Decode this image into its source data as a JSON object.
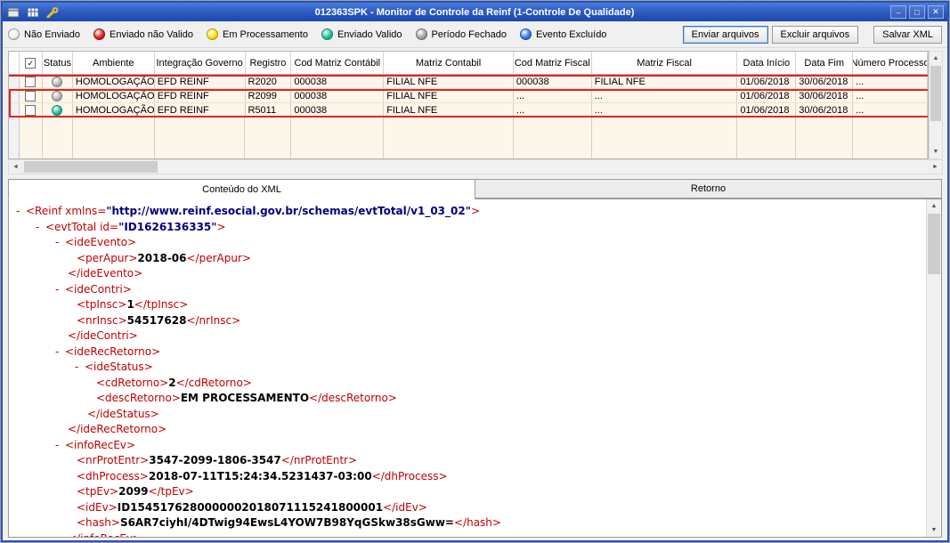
{
  "window": {
    "title": "012363SPK - Monitor de Controle da Reinf (1-Controle De Qualidade)"
  },
  "icons": {
    "minimize": "–",
    "maximize": "□",
    "close": "✕",
    "check": "✓",
    "up": "▲",
    "down": "▼",
    "left": "◄",
    "right": "►"
  },
  "legend": {
    "items": [
      {
        "label": "Não Enviado",
        "color": "#f2f2f2",
        "edge": "#9a9a9a"
      },
      {
        "label": "Enviado não Valido",
        "color": "#e22820",
        "edge": "#8f100c"
      },
      {
        "label": "Em Processamento",
        "color": "#ffe312",
        "edge": "#b09a00"
      },
      {
        "label": "Enviado Valido",
        "color": "#23bd9a",
        "edge": "#0e8a6e"
      },
      {
        "label": "Período Fechado",
        "color": "#a6a6a6",
        "edge": "#6e6e6e"
      },
      {
        "label": "Evento Excluído",
        "color": "#3b7fe0",
        "edge": "#1a4e9e"
      }
    ]
  },
  "actions": {
    "send": "Enviar arquivos",
    "delete": "Excluir arquivos",
    "save": "Salvar XML"
  },
  "grid": {
    "columns": [
      "",
      "",
      "Status",
      "Ambiente",
      "Integração Governo",
      "Registro",
      "Cod Matriz Contábil",
      "Matriz Contabil",
      "Cod Matriz Fiscal",
      "Matriz Fiscal",
      "Data Início",
      "Data Fim",
      "Número Processo"
    ],
    "status_colors": {
      "gray": {
        "fill": "#b8b8b8",
        "edge": "#7e7e7e"
      },
      "green": {
        "fill": "#23bd9a",
        "edge": "#0e8a6e"
      }
    },
    "rows": [
      {
        "checked": false,
        "status": "gray",
        "cells": [
          "HOMOLOGAÇÃO",
          "EFD REINF",
          "R2020",
          "000038",
          "FILIAL NFE",
          "000038",
          "FILIAL NFE",
          "01/06/2018",
          "30/06/2018",
          "..."
        ]
      },
      {
        "checked": false,
        "status": "gray",
        "cells": [
          "HOMOLOGAÇÃO",
          "EFD REINF",
          "R2099",
          "000038",
          "FILIAL NFE",
          "...",
          "...",
          "01/06/2018",
          "30/06/2018",
          "..."
        ]
      },
      {
        "checked": false,
        "status": "green",
        "cells": [
          "HOMOLOGAÇÃO",
          "EFD REINF",
          "R5011",
          "000038",
          "FILIAL NFE",
          "...",
          "...",
          "01/06/2018",
          "30/06/2018",
          "..."
        ]
      }
    ]
  },
  "tabs": [
    {
      "label": "Conteúdo do XML"
    },
    {
      "label": "Retorno"
    }
  ],
  "xml": {
    "lines": [
      {
        "pad": 8,
        "m": true,
        "p": [
          {
            "t": "tag",
            "v": "<Reinf xmlns="
          },
          {
            "t": "val",
            "v": "\"http://www.reinf.esocial.gov.br/schemas/evtTotal/v1_03_02\""
          },
          {
            "t": "tag",
            "v": ">"
          }
        ]
      },
      {
        "pad": 30,
        "m": true,
        "p": [
          {
            "t": "tag",
            "v": "<evtTotal id="
          },
          {
            "t": "val",
            "v": "\"ID1626136335\""
          },
          {
            "t": "tag",
            "v": ">"
          }
        ]
      },
      {
        "pad": 52,
        "m": true,
        "p": [
          {
            "t": "tag",
            "v": "<ideEvento>"
          }
        ]
      },
      {
        "pad": 76,
        "m": false,
        "p": [
          {
            "t": "tag",
            "v": "<perApur>"
          },
          {
            "t": "txt",
            "v": "2018-06"
          },
          {
            "t": "tag",
            "v": "</perApur>"
          }
        ]
      },
      {
        "pad": 66,
        "m": false,
        "p": [
          {
            "t": "tag",
            "v": "</ideEvento>"
          }
        ]
      },
      {
        "pad": 52,
        "m": true,
        "p": [
          {
            "t": "tag",
            "v": "<ideContri>"
          }
        ]
      },
      {
        "pad": 76,
        "m": false,
        "p": [
          {
            "t": "tag",
            "v": "<tpInsc>"
          },
          {
            "t": "txt",
            "v": "1"
          },
          {
            "t": "tag",
            "v": "</tpInsc>"
          }
        ]
      },
      {
        "pad": 76,
        "m": false,
        "p": [
          {
            "t": "tag",
            "v": "<nrInsc>"
          },
          {
            "t": "txt",
            "v": "54517628"
          },
          {
            "t": "tag",
            "v": "</nrInsc>"
          }
        ]
      },
      {
        "pad": 66,
        "m": false,
        "p": [
          {
            "t": "tag",
            "v": "</ideContri>"
          }
        ]
      },
      {
        "pad": 52,
        "m": true,
        "p": [
          {
            "t": "tag",
            "v": "<ideRecRetorno>"
          }
        ]
      },
      {
        "pad": 74,
        "m": true,
        "p": [
          {
            "t": "tag",
            "v": "<ideStatus>"
          }
        ]
      },
      {
        "pad": 98,
        "m": false,
        "p": [
          {
            "t": "tag",
            "v": "<cdRetorno>"
          },
          {
            "t": "txt",
            "v": "2"
          },
          {
            "t": "tag",
            "v": "</cdRetorno>"
          }
        ]
      },
      {
        "pad": 98,
        "m": false,
        "p": [
          {
            "t": "tag",
            "v": "<descRetorno>"
          },
          {
            "t": "txt",
            "v": "EM PROCESSAMENTO"
          },
          {
            "t": "tag",
            "v": "</descRetorno>"
          }
        ]
      },
      {
        "pad": 88,
        "m": false,
        "p": [
          {
            "t": "tag",
            "v": "</ideStatus>"
          }
        ]
      },
      {
        "pad": 66,
        "m": false,
        "p": [
          {
            "t": "tag",
            "v": "</ideRecRetorno>"
          }
        ]
      },
      {
        "pad": 52,
        "m": true,
        "p": [
          {
            "t": "tag",
            "v": "<infoRecEv>"
          }
        ]
      },
      {
        "pad": 76,
        "m": false,
        "p": [
          {
            "t": "tag",
            "v": "<nrProtEntr>"
          },
          {
            "t": "txt",
            "v": "3547-2099-1806-3547"
          },
          {
            "t": "tag",
            "v": "</nrProtEntr>"
          }
        ]
      },
      {
        "pad": 76,
        "m": false,
        "p": [
          {
            "t": "tag",
            "v": "<dhProcess>"
          },
          {
            "t": "txt",
            "v": "2018-07-11T15:24:34.5231437-03:00"
          },
          {
            "t": "tag",
            "v": "</dhProcess>"
          }
        ]
      },
      {
        "pad": 76,
        "m": false,
        "p": [
          {
            "t": "tag",
            "v": "<tpEv>"
          },
          {
            "t": "txt",
            "v": "2099"
          },
          {
            "t": "tag",
            "v": "</tpEv>"
          }
        ]
      },
      {
        "pad": 76,
        "m": false,
        "p": [
          {
            "t": "tag",
            "v": "<idEv>"
          },
          {
            "t": "txt",
            "v": "ID1545176280000002018071115241800001"
          },
          {
            "t": "tag",
            "v": "</idEv>"
          }
        ]
      },
      {
        "pad": 76,
        "m": false,
        "p": [
          {
            "t": "tag",
            "v": "<hash>"
          },
          {
            "t": "txt",
            "v": "S6AR7ciyhI/4DTwig94EwsL4YOW7B98YqGSkw38sGww="
          },
          {
            "t": "tag",
            "v": "</hash>"
          }
        ]
      },
      {
        "pad": 66,
        "m": false,
        "p": [
          {
            "t": "tag",
            "v": "</infoRecEv>"
          }
        ]
      }
    ]
  }
}
